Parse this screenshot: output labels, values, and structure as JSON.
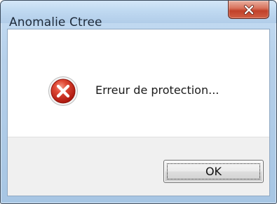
{
  "window": {
    "title": "Anomalie Ctree",
    "close_icon": "close-icon"
  },
  "message": {
    "icon": "error-icon",
    "text": "Erreur de protection..."
  },
  "buttons": {
    "ok_label": "OK"
  },
  "colors": {
    "titlebar": "#c0d9f1",
    "close_button": "#c1412a",
    "error_icon": "#d0241a",
    "button_strip": "#f0f0f0"
  }
}
